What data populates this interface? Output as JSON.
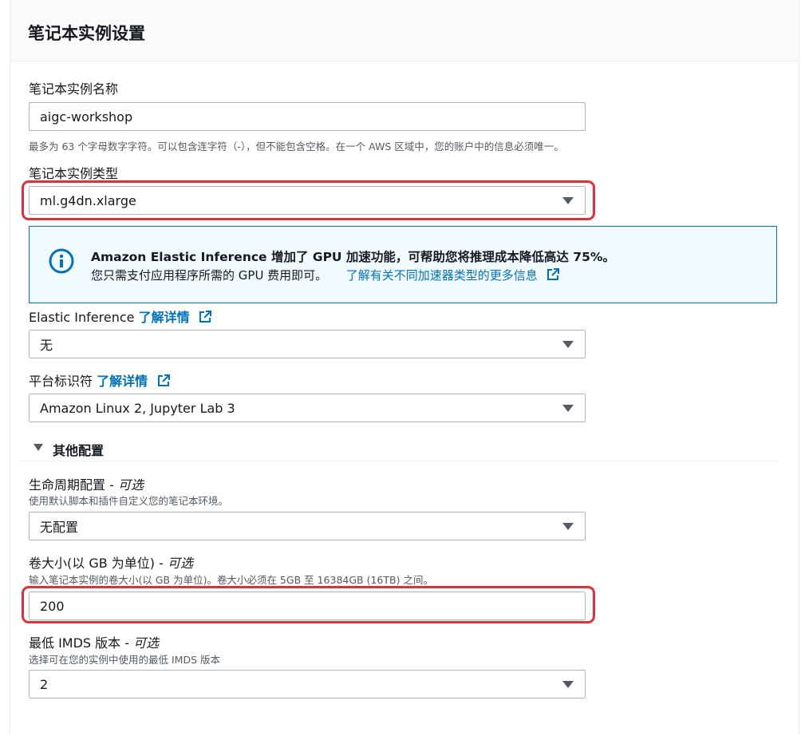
{
  "section": {
    "title": "笔记本实例设置"
  },
  "instance_name": {
    "label": "笔记本实例名称",
    "value": "aigc-workshop",
    "hint": "最多为 63 个字母数字字符。可以包含连字符（-），但不能包含空格。在一个 AWS 区域中，您的账户中的信息必须唯一。"
  },
  "instance_type": {
    "label": "笔记本实例类型",
    "value": "ml.g4dn.xlarge"
  },
  "info_alert": {
    "icon": "info-icon",
    "headline": "Amazon Elastic Inference 增加了 GPU 加速功能，可帮助您将推理成本降低高达 75%。",
    "body": "您只需支付应用程序所需的 GPU 费用即可。",
    "link": "了解有关不同加速器类型的更多信息"
  },
  "elastic_inference": {
    "label": "Elastic Inference",
    "link": "了解详情",
    "value": "无"
  },
  "platform": {
    "label": "平台标识符",
    "link": "了解详情",
    "value": "Amazon Linux 2, Jupyter Lab 3"
  },
  "other_config": {
    "title": "其他配置"
  },
  "lifecycle": {
    "label": "生命周期配置 -",
    "optional": "可选",
    "desc": "使用默认脚本和插件自定义您的笔记本环境。",
    "value": "无配置"
  },
  "volume": {
    "label": "卷大小(以 GB 为单位) -",
    "optional": "可选",
    "desc": "输入笔记本实例的卷大小(以 GB 为单位)。卷大小必须在 5GB 至 16384GB (16TB) 之间。",
    "value": "200"
  },
  "imds": {
    "label": "最低 IMDS 版本 -",
    "optional": "可选",
    "desc": "选择可在您的实例中使用的最低 IMDS 版本",
    "value": "2"
  },
  "colors": {
    "link": "#0073bb",
    "highlight": "#e0303a",
    "info_bg": "#f1faff"
  }
}
